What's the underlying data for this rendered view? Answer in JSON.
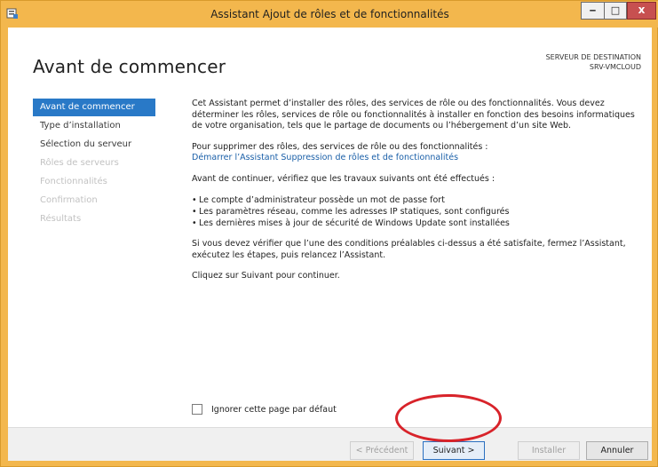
{
  "window": {
    "title": "Assistant Ajout de rôles et de fonctionnalités",
    "controls": {
      "minimize": "‒",
      "maximize": "□",
      "close": "x"
    }
  },
  "header": {
    "page_title": "Avant de commencer",
    "destination_label": "SERVEUR DE DESTINATION",
    "destination_server": "SRV-VMCLOUD"
  },
  "nav": {
    "items": [
      {
        "label": "Avant de commencer",
        "state": "active"
      },
      {
        "label": "Type d’installation",
        "state": "enabled"
      },
      {
        "label": "Sélection du serveur",
        "state": "enabled"
      },
      {
        "label": "Rôles de serveurs",
        "state": "disabled"
      },
      {
        "label": "Fonctionnalités",
        "state": "disabled"
      },
      {
        "label": "Confirmation",
        "state": "disabled"
      },
      {
        "label": "Résultats",
        "state": "disabled"
      }
    ]
  },
  "content": {
    "intro": "Cet Assistant permet d’installer des rôles, des services de rôle ou des fonctionnalités. Vous devez déterminer les rôles, services de rôle ou fonctionnalités à installer en fonction des besoins informatiques de votre organisation, tels que le partage de documents ou l’hébergement d’un site Web.",
    "remove_text": "Pour supprimer des rôles, des services de rôle ou des fonctionnalités :",
    "remove_link": "Démarrer l’Assistant Suppression de rôles et de fonctionnalités",
    "before_text": "Avant de continuer, vérifiez que les travaux suivants ont été effectués :",
    "bullets": [
      "Le compte d’administrateur possède un mot de passe fort",
      "Les paramètres réseau, comme les adresses IP statiques, sont configurés",
      "Les dernières mises à jour de sécurité de Windows Update sont installées"
    ],
    "verify_text": "Si vous devez vérifier que l’une des conditions préalables ci-dessus a été satisfaite, fermez l’Assistant, exécutez les étapes, puis relancez l’Assistant.",
    "continue_text": "Cliquez sur Suivant pour continuer."
  },
  "checkbox": {
    "label": "Ignorer cette page par défaut",
    "checked": false
  },
  "buttons": {
    "prev": "< Précédent",
    "next": "Suivant >",
    "install": "Installer",
    "cancel": "Annuler"
  },
  "colors": {
    "title_bar": "#f3b74d",
    "nav_active": "#2979c7",
    "link": "#1a5fa8",
    "annotation": "#d8232a"
  }
}
